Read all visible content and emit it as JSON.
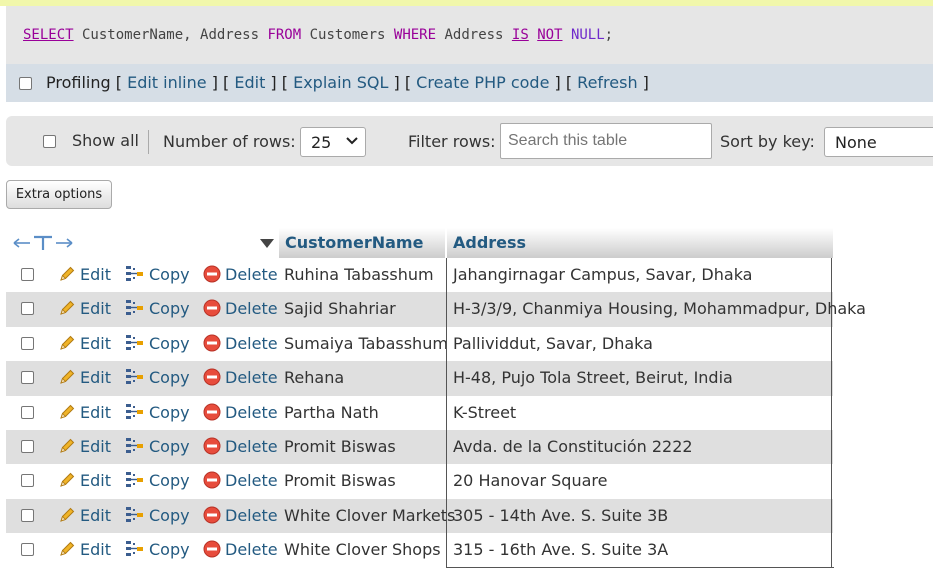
{
  "sql": {
    "select": "SELECT",
    "cols": " CustomerName, Address ",
    "from": "FROM",
    "table": " Customers ",
    "where": "WHERE",
    "col": " Address ",
    "is": "IS",
    "not": "NOT",
    "null": "NULL",
    "end": ";"
  },
  "profiling": {
    "label": "Profiling",
    "edit_inline": "Edit inline",
    "edit": "Edit",
    "explain": "Explain SQL",
    "php": "Create PHP code",
    "refresh": "Refresh"
  },
  "nav": {
    "show_all": "Show all",
    "num_rows_label": "Number of rows:",
    "num_rows_value": "25",
    "filter_label": "Filter rows:",
    "search_placeholder": "Search this table",
    "sort_label": "Sort by key:",
    "sort_value": "None"
  },
  "extra_options": "Extra options",
  "table": {
    "columns": [
      "CustomerName",
      "Address"
    ],
    "actions": {
      "edit": "Edit",
      "copy": "Copy",
      "delete": "Delete"
    },
    "rows": [
      {
        "name": "Ruhina Tabasshum",
        "address": "Jahangirnagar Campus, Savar, Dhaka"
      },
      {
        "name": "Sajid Shahriar",
        "address": "H-3/3/9, Chanmiya Housing, Mohammadpur, Dhaka"
      },
      {
        "name": "Sumaiya Tabasshum",
        "address": "Pallividdut, Savar, Dhaka"
      },
      {
        "name": "Rehana",
        "address": "H-48, Pujo Tola Street, Beirut, India"
      },
      {
        "name": "Partha Nath",
        "address": "K-Street"
      },
      {
        "name": "Promit Biswas",
        "address": "Avda. de la Constitución 2222"
      },
      {
        "name": "Promit Biswas",
        "address": "20 Hanovar Square"
      },
      {
        "name": "White Clover Markets",
        "address": "305 - 14th Ave. S. Suite 3B"
      },
      {
        "name": "White Clover Shops",
        "address": "315 - 16th Ave. S. Suite 3A"
      }
    ]
  },
  "colors": {
    "link": "#235a81",
    "keyword": "#990099",
    "stripe": "#dfdfdf",
    "delete": "#e74c3c",
    "pencil": "#f0b428"
  }
}
